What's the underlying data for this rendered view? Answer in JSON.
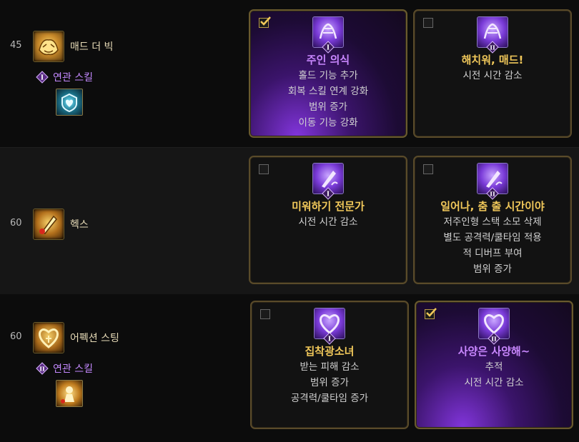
{
  "rows": [
    {
      "level": "45",
      "skill_name": "매드 더 빅",
      "related_label": "연관 스킬",
      "related_rune": "I",
      "options": [
        {
          "rune": "I",
          "title": "주인 의식",
          "selected": true,
          "lines": [
            "홀드 기능 추가",
            "회복 스킬 연계 강화",
            "범위 증가",
            "이동 기능 강화"
          ]
        },
        {
          "rune": "II",
          "title": "해치워, 매드!",
          "selected": false,
          "lines": [
            "시전 시간 감소"
          ]
        }
      ]
    },
    {
      "level": "60",
      "skill_name": "헥스",
      "options": [
        {
          "rune": "I",
          "title": "미워하기 전문가",
          "selected": false,
          "lines": [
            "시전 시간 감소"
          ]
        },
        {
          "rune": "II",
          "title": "일어나, 춤 출 시간이야",
          "selected": false,
          "lines": [
            "저주인형 스택 소모 삭제",
            "별도 공격력/쿨타임 적용",
            "적 디버프 부여",
            "범위 증가"
          ]
        }
      ]
    },
    {
      "level": "60",
      "skill_name": "어펙션 스팅",
      "related_label": "연관 스킬",
      "related_rune": "II",
      "options": [
        {
          "rune": "I",
          "title": "집착광소녀",
          "selected": false,
          "lines": [
            "받는 피해 감소",
            "범위 증가",
            "공격력/쿨타임 증가"
          ]
        },
        {
          "rune": "II",
          "title": "사양은 사양해~",
          "selected": true,
          "lines": [
            "추적",
            "시전 시간 감소"
          ]
        }
      ]
    }
  ],
  "icons": {
    "skill_1": "mad-the-big-icon",
    "skill_2": "hex-icon",
    "skill_3": "affection-sting-icon",
    "related_1": "heart-shield-icon",
    "related_3": "golden-doll-icon",
    "checkbox_checked": "checkmark-icon"
  },
  "colors": {
    "accent_gold": "#f1c85a",
    "accent_purple": "#c987ff",
    "card_border": "#5a4b2a"
  }
}
